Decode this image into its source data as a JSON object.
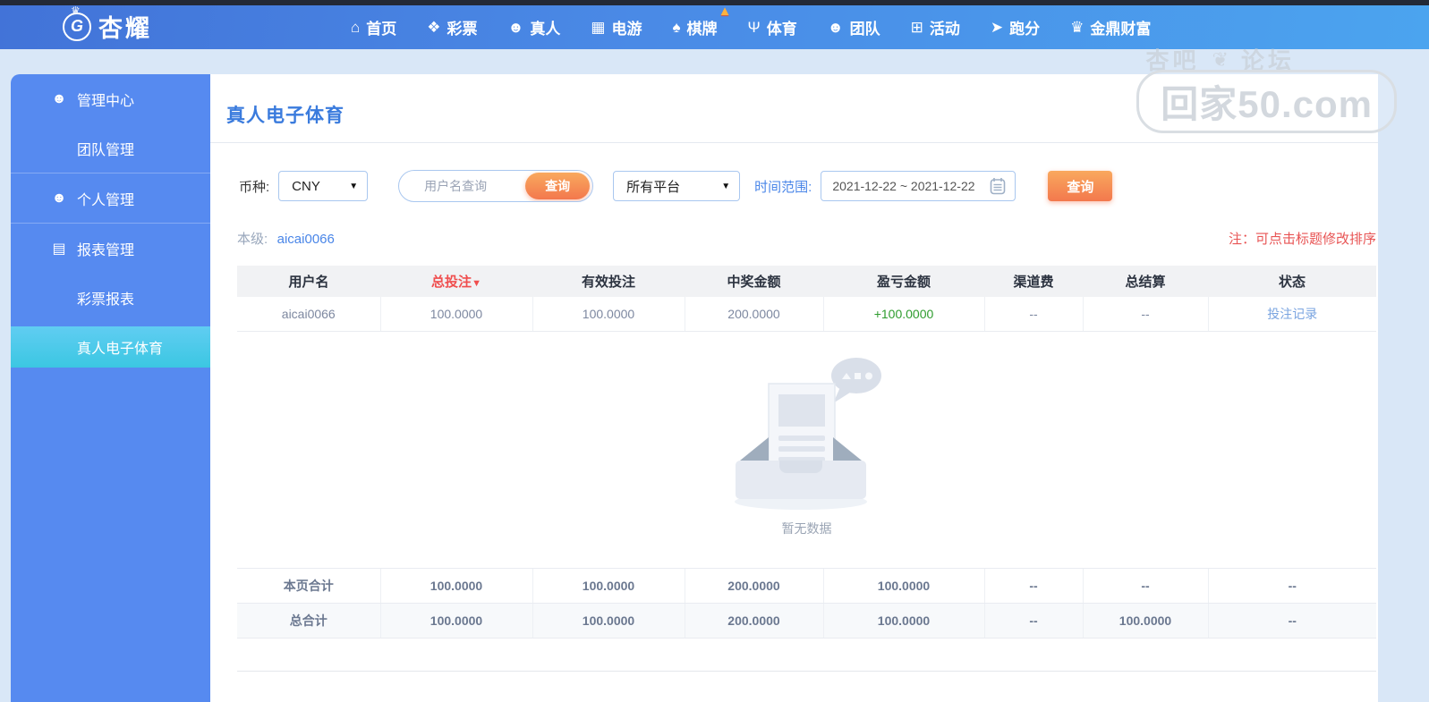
{
  "topnav": {
    "logo_text": "杏耀",
    "logo_letter": "G",
    "items": [
      {
        "label": "首页",
        "glyph": "⌂"
      },
      {
        "label": "彩票",
        "glyph": "❖"
      },
      {
        "label": "真人",
        "glyph": "☻"
      },
      {
        "label": "电游",
        "glyph": "▦"
      },
      {
        "label": "棋牌",
        "glyph": "♠",
        "badge": "▲"
      },
      {
        "label": "体育",
        "glyph": "Ψ"
      },
      {
        "label": "团队",
        "glyph": "☻"
      },
      {
        "label": "活动",
        "glyph": "⊞"
      },
      {
        "label": "跑分",
        "glyph": "➤"
      },
      {
        "label": "金鼎财富",
        "glyph": "♛"
      }
    ]
  },
  "watermark": {
    "forum_left": "杏吧",
    "forum_right": "论坛",
    "ornament": "❦",
    "site": "回家50.com"
  },
  "sidebar": {
    "items": [
      {
        "label": "管理中心",
        "glyph": "☻"
      },
      {
        "label": "团队管理"
      },
      {
        "label": "个人管理",
        "glyph": "☻"
      },
      {
        "label": "报表管理",
        "glyph": "▤"
      },
      {
        "label": "彩票报表"
      },
      {
        "label": "真人电子体育"
      }
    ]
  },
  "main": {
    "title": "真人电子体育",
    "filters": {
      "currency_label": "币种:",
      "currency_value": "CNY",
      "select_arrow": "▼",
      "username_placeholder": "用户名查询",
      "inline_search_label": "查询",
      "platform_value": "所有平台",
      "date_label": "时间范围:",
      "date_value": "2021-12-22 ~ 2021-12-22",
      "search_label": "查询"
    },
    "level_label": "本级:",
    "level_value": "aicai0066",
    "sort_note": "注：可点击标题修改排序",
    "table": {
      "sort_arrow": "▼",
      "headers": [
        "用户名",
        "总投注",
        "有效投注",
        "中奖金额",
        "盈亏金额",
        "渠道费",
        "总结算",
        "状态"
      ],
      "row": {
        "username": "aicai0066",
        "total_bet": "100.0000",
        "valid_bet": "100.0000",
        "win_amount": "200.0000",
        "profit": "+100.0000",
        "channel_fee": "--",
        "settlement": "--",
        "status_link": "投注记录"
      },
      "empty_text": "暂无数据",
      "page_total": {
        "label": "本页合计",
        "values": [
          "100.0000",
          "100.0000",
          "200.0000",
          "100.0000",
          "--",
          "--",
          "--"
        ]
      },
      "grand_total": {
        "label": "总合计",
        "values": [
          "100.0000",
          "100.0000",
          "200.0000",
          "100.0000",
          "--",
          "100.0000",
          "--"
        ]
      }
    }
  },
  "colors": {
    "nav_blue": "#4a8ae6",
    "sidebar_blue": "#568af0",
    "active_cyan": "#3bc7e2",
    "accent_orange": "#f3784d",
    "title_blue": "#3a7bdd",
    "note_red": "#e85454",
    "profit_green": "#2e9c2e",
    "link_blue": "#7aa4e0"
  }
}
